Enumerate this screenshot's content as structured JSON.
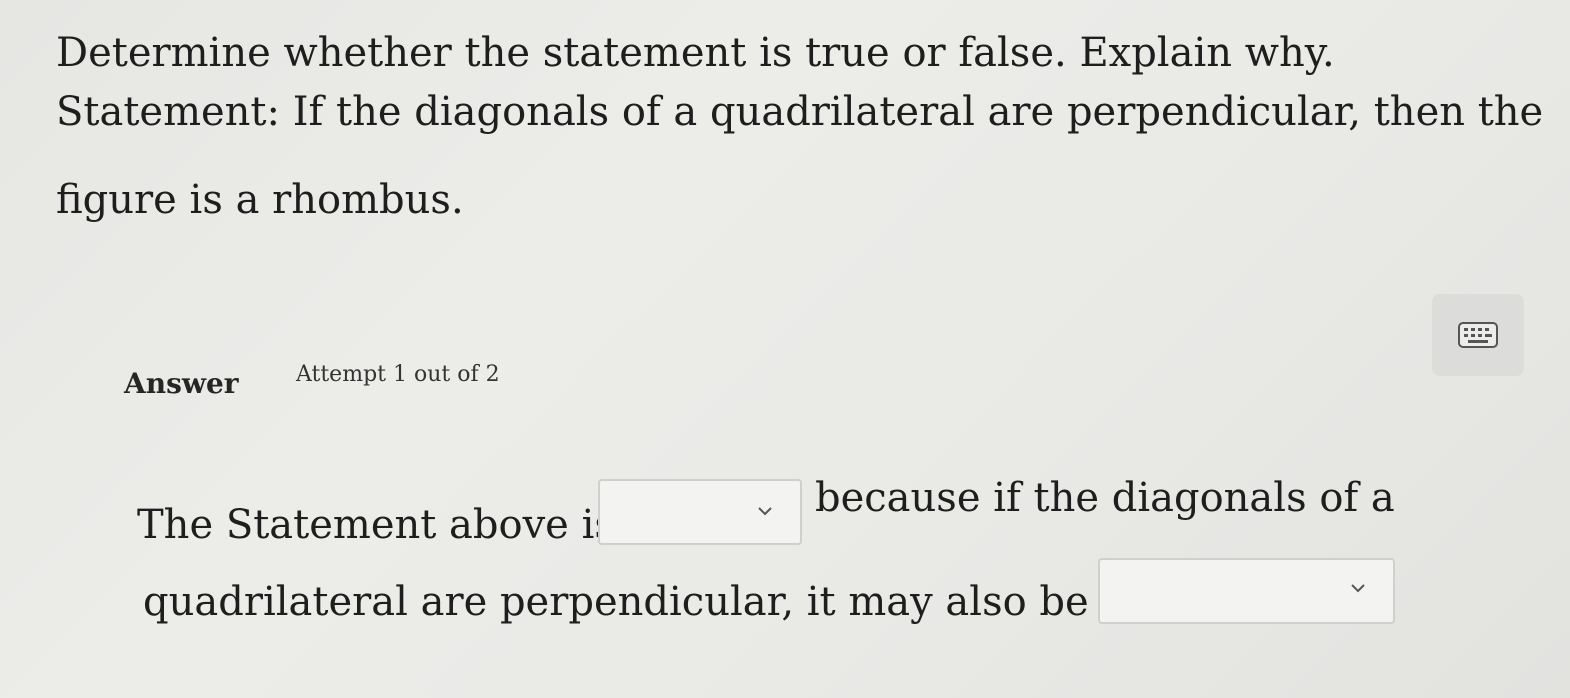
{
  "question": {
    "line1": "Determine whether the statement is true or false. Explain why.",
    "line2": "Statement: If the diagonals of a quadrilateral are perpendicular, then the",
    "line3": "figure is a rhombus."
  },
  "answer_header": {
    "label": "Answer",
    "attempt": "Attempt 1 out of 2"
  },
  "keyboard_button": {
    "icon": "keyboard-icon"
  },
  "answer_sentence": {
    "part1": "The Statement above is",
    "part2": "because if the diagonals of a",
    "part3": "quadrilateral are perpendicular, it may also be a"
  },
  "dropdowns": {
    "first_value": "",
    "second_value": ""
  }
}
